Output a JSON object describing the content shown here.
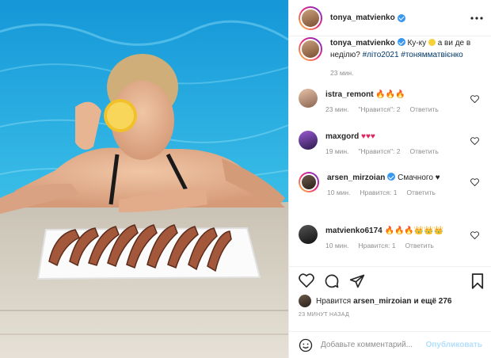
{
  "post": {
    "author": "tonya_matvienko",
    "more_icon": "more-horizontal-icon",
    "caption": {
      "user": "tonya_matvienko",
      "text_a": "Ку-ку",
      "text_b": "а ви де в неділю?",
      "hashtags": "#літо2021 #тонямматвієнко",
      "time": "23 мин."
    }
  },
  "comments": [
    {
      "user": "istra_remont",
      "text": "🔥🔥🔥",
      "time": "23 мин.",
      "likes": "\"Нравится\": 2",
      "reply": "Ответить",
      "verified": false
    },
    {
      "user": "maxgord",
      "text": "♥♥♥",
      "time": "19 мин.",
      "likes": "\"Нравится\": 2",
      "reply": "Ответить",
      "verified": false
    },
    {
      "user": "arsen_mirzoian",
      "text": "Смачного ♥",
      "time": "10 мин.",
      "likes": "Нравится: 1",
      "reply": "Ответить",
      "verified": true
    },
    {
      "user": "matvienko6174",
      "text": "🔥🔥🔥👑👑👑",
      "time": "10 мин.",
      "likes": "Нравится: 1",
      "reply": "Ответить",
      "verified": false
    }
  ],
  "likes": {
    "prefix": "Нравится",
    "user": "arsen_mirzoian",
    "suffix": "и ещё 276"
  },
  "time_ago": "23 МИНУТ НАЗАД",
  "add_comment": {
    "placeholder": "Добавьте комментарий...",
    "publish": "Опубликовать"
  },
  "colors": {
    "accent": "#3897f0",
    "link": "#00376b",
    "muted": "#8e8e8e",
    "pool": "#2aa6d6"
  }
}
